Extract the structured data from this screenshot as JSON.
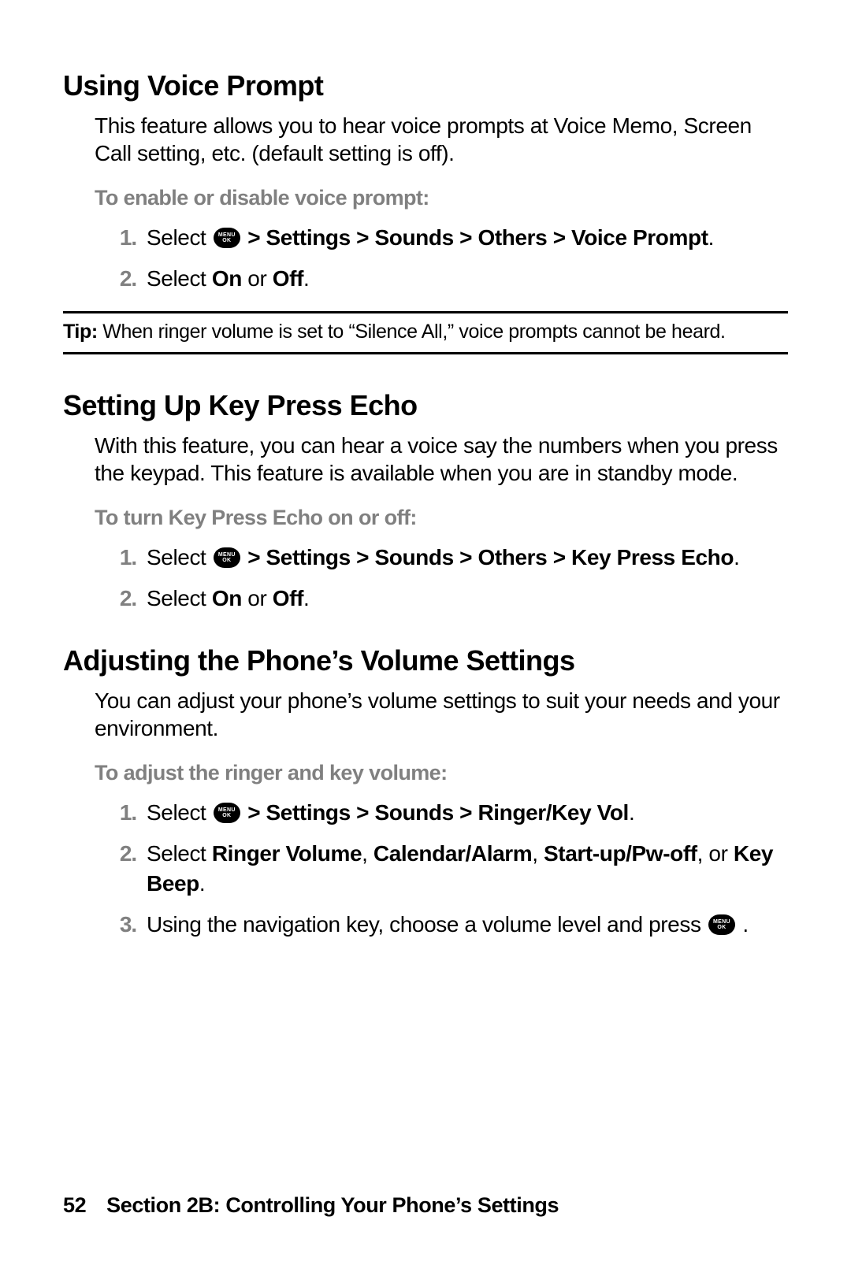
{
  "s1": {
    "heading": "Using Voice Prompt",
    "intro": "This feature allows you to hear voice prompts at Voice Memo, Screen Call setting, etc. (default setting is off).",
    "lead": "To enable or disable voice prompt:",
    "step1_a": "Select ",
    "step1_b": " > Settings > Sounds > Others > Voice Prompt",
    "step1_c": ".",
    "step2_a": "Select ",
    "step2_b": "On",
    "step2_c": " or ",
    "step2_d": "Off",
    "step2_e": "."
  },
  "tip": {
    "label": "Tip:",
    "text": " When ringer volume is set to “Silence All,” voice prompts cannot be heard."
  },
  "s2": {
    "heading": "Setting Up Key Press Echo",
    "intro": "With this feature, you can hear a voice say the numbers when you press the keypad. This feature is available when you are in standby mode.",
    "lead": "To turn Key Press Echo on or off:",
    "step1_a": "Select ",
    "step1_b": " > Settings > Sounds > Others > Key Press Echo",
    "step1_c": ".",
    "step2_a": "Select ",
    "step2_b": "On",
    "step2_c": " or ",
    "step2_d": "Off",
    "step2_e": "."
  },
  "s3": {
    "heading": "Adjusting the Phone’s Volume Settings",
    "intro": "You can adjust your phone’s volume settings to suit your needs and your environment.",
    "lead": "To adjust the ringer and key volume:",
    "step1_a": "Select ",
    "step1_b": " > Settings > Sounds > Ringer/Key Vol",
    "step1_c": ".",
    "step2_a": "Select ",
    "step2_b": "Ringer Volume",
    "step2_c": ", ",
    "step2_d": "Calendar/Alarm",
    "step2_e": ", ",
    "step2_f": "Start-up/Pw-off",
    "step2_g": ", or ",
    "step2_h": "Key Beep",
    "step2_i": ".",
    "step3_a": "Using the navigation key, choose a volume level and press ",
    "step3_b": " ."
  },
  "footer": {
    "page": "52",
    "text": "Section 2B: Controlling Your Phone’s Settings"
  }
}
